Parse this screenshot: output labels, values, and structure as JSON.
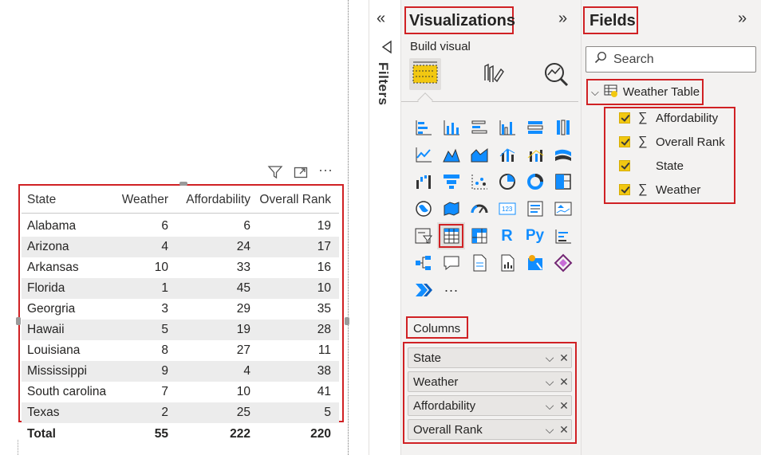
{
  "table": {
    "headers": [
      "State",
      "Weather",
      "Affordability",
      "Overall Rank"
    ],
    "rows": [
      [
        "Alabama",
        "6",
        "6",
        "19"
      ],
      [
        "Arizona",
        "4",
        "24",
        "17"
      ],
      [
        "Arkansas",
        "10",
        "33",
        "16"
      ],
      [
        "Florida",
        "1",
        "45",
        "10"
      ],
      [
        "Georgria",
        "3",
        "29",
        "35"
      ],
      [
        "Hawaii",
        "5",
        "19",
        "28"
      ],
      [
        "Louisiana",
        "8",
        "27",
        "11"
      ],
      [
        "Mississippi",
        "9",
        "4",
        "38"
      ],
      [
        "South carolina",
        "7",
        "10",
        "41"
      ],
      [
        "Texas",
        "2",
        "25",
        "5"
      ]
    ],
    "total": [
      "Total",
      "55",
      "222",
      "220"
    ]
  },
  "visual_header": {
    "icons": [
      "filter-icon",
      "focus-mode-icon",
      "more-options-icon"
    ],
    "more": "···"
  },
  "filters": {
    "label": "Filters",
    "collapse": "«"
  },
  "visualizations": {
    "title": "Visualizations",
    "expand": "»",
    "build_visual": "Build visual",
    "columns_label": "Columns",
    "wells": [
      {
        "label": "State"
      },
      {
        "label": "Weather"
      },
      {
        "label": "Affordability"
      },
      {
        "label": "Overall Rank"
      }
    ],
    "more_visuals": "···"
  },
  "fields": {
    "title": "Fields",
    "expand": "»",
    "search_placeholder": "Search",
    "table_name": "Weather Table",
    "items": [
      {
        "label": "Affordability",
        "sigma": "∑"
      },
      {
        "label": "Overall Rank",
        "sigma": "∑"
      },
      {
        "label": "State",
        "sigma": ""
      },
      {
        "label": "Weather",
        "sigma": "∑"
      }
    ]
  },
  "colors": {
    "accent": "#f2c811",
    "highlight": "#d02124",
    "powerbi_blue": "#118dff"
  }
}
